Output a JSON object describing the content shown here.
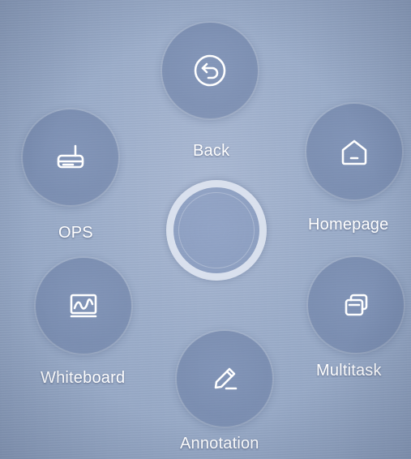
{
  "menu": {
    "back": {
      "label": "Back",
      "icon": "back-arrow-icon"
    },
    "ops": {
      "label": "OPS",
      "icon": "ops-device-icon"
    },
    "homepage": {
      "label": "Homepage",
      "icon": "home-icon"
    },
    "whiteboard": {
      "label": "Whiteboard",
      "icon": "whiteboard-icon"
    },
    "multitask": {
      "label": "Multitask",
      "icon": "multitask-icon"
    },
    "annotation": {
      "label": "Annotation",
      "icon": "pen-icon"
    }
  },
  "colors": {
    "background": "#9aacc9",
    "button_fill": "#6e82aa",
    "icon": "#ffffff",
    "label": "#ffffff"
  }
}
